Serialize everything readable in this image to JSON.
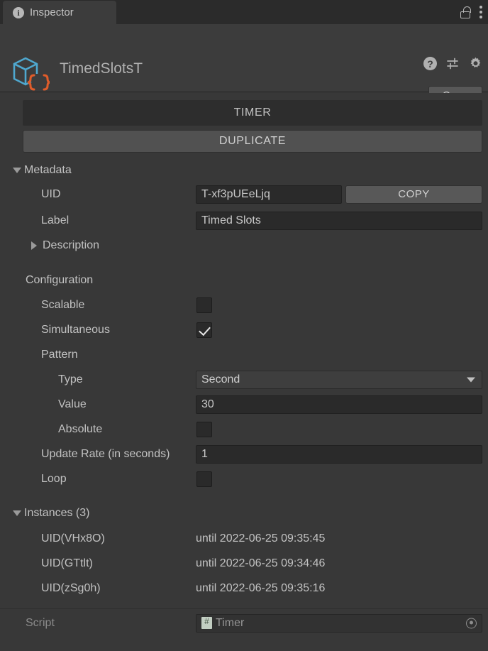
{
  "window": {
    "tab_label": "Inspector",
    "tab_icon": "info-icon",
    "lock_icon": "lock-icon",
    "menu_icon": "kebab-menu-icon"
  },
  "object_header": {
    "icon": "scriptable-object-icon",
    "title": "TimedSlotsT",
    "help_icon": "help-icon",
    "preset_icon": "preset-icon",
    "settings_icon": "gear-icon",
    "open_label": "Open"
  },
  "main": {
    "type_header": "TIMER",
    "duplicate_label": "DUPLICATE",
    "metadata": {
      "section_label": "Metadata",
      "expanded": true,
      "uid_label": "UID",
      "uid_value": "T-xf3pUEeLjq",
      "copy_label": "COPY",
      "label_label": "Label",
      "label_value": "Timed Slots",
      "description_label": "Description",
      "description_expanded": false
    },
    "configuration": {
      "section_label": "Configuration",
      "scalable_label": "Scalable",
      "scalable_checked": false,
      "simultaneous_label": "Simultaneous",
      "simultaneous_checked": true,
      "pattern_label": "Pattern",
      "type_label": "Type",
      "type_value": "Second",
      "value_label": "Value",
      "value_value": "30",
      "absolute_label": "Absolute",
      "absolute_checked": false,
      "update_rate_label": "Update Rate (in seconds)",
      "update_rate_value": "1",
      "loop_label": "Loop",
      "loop_checked": false
    },
    "instances": {
      "section_label": "Instances (3)",
      "expanded": true,
      "items": [
        {
          "uid": "UID(VHx8O)",
          "expiry": "until 2022-06-25 09:35:45"
        },
        {
          "uid": "UID(GTtlt)",
          "expiry": "until 2022-06-25 09:34:46"
        },
        {
          "uid": "UID(zSg0h)",
          "expiry": "until 2022-06-25 09:35:16"
        }
      ]
    },
    "script": {
      "label": "Script",
      "value": "Timer",
      "icon": "csharp-script-icon",
      "picker_icon": "object-picker-icon"
    }
  },
  "colors": {
    "background": "#383838",
    "panel": "#3c3c3c",
    "tabbar": "#2b2b2b",
    "field": "#2a2a2a",
    "button": "#585858",
    "duplicate_button": "#515151",
    "text": "#c2c2c2",
    "text_dim": "#8a8a8a",
    "icon_cube": "#4fa8cf",
    "icon_braces": "#e05c2a"
  }
}
